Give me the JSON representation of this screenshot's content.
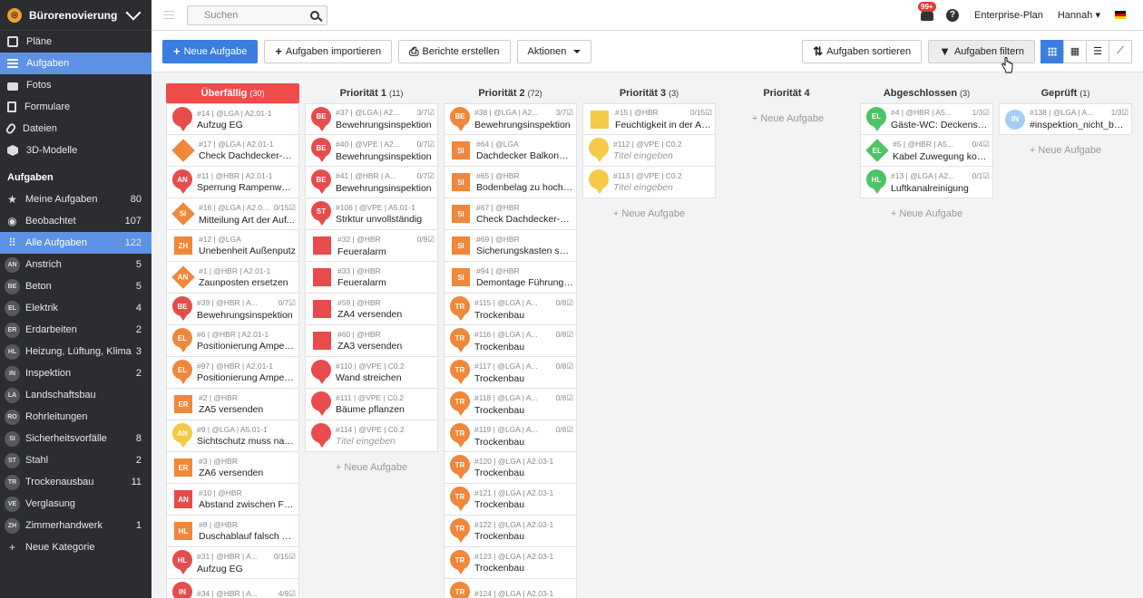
{
  "sidebar": {
    "project": "Bürorenovierung",
    "nav": [
      {
        "label": "Pläne",
        "icon": "plans-icon"
      },
      {
        "label": "Aufgaben",
        "icon": "list-icon",
        "active": true
      },
      {
        "label": "Fotos",
        "icon": "camera-icon"
      },
      {
        "label": "Formulare",
        "icon": "form-icon"
      },
      {
        "label": "Dateien",
        "icon": "paperclip-icon"
      },
      {
        "label": "3D-Modelle",
        "icon": "cube-icon"
      }
    ],
    "section_title": "Aufgaben",
    "filters": [
      {
        "label": "Meine Aufgaben",
        "count": "80",
        "sym": "★"
      },
      {
        "label": "Beobachtet",
        "count": "107",
        "sym": "◉"
      },
      {
        "label": "Alle Aufgaben",
        "count": "122",
        "sym": "⠿",
        "active": true
      }
    ],
    "categories": [
      {
        "badge": "AN",
        "label": "Anstrich",
        "count": "5"
      },
      {
        "badge": "BE",
        "label": "Beton",
        "count": "5"
      },
      {
        "badge": "EL",
        "label": "Elektrik",
        "count": "4"
      },
      {
        "badge": "ER",
        "label": "Erdarbeiten",
        "count": "2"
      },
      {
        "badge": "HL",
        "label": "Heizung, Lüftung, Klima",
        "count": "3"
      },
      {
        "badge": "IN",
        "label": "Inspektion",
        "count": "2"
      },
      {
        "badge": "LA",
        "label": "Landschaftsbau",
        "count": ""
      },
      {
        "badge": "RO",
        "label": "Rohrleitungen",
        "count": ""
      },
      {
        "badge": "SI",
        "label": "Sicherheitsvorfälle",
        "count": "8"
      },
      {
        "badge": "ST",
        "label": "Stahl",
        "count": "2"
      },
      {
        "badge": "TR",
        "label": "Trockenausbau",
        "count": "11"
      },
      {
        "badge": "VE",
        "label": "Verglasung",
        "count": ""
      },
      {
        "badge": "ZH",
        "label": "Zimmerhandwerk",
        "count": "1"
      }
    ],
    "new_category": "Neue Kategorie"
  },
  "topbar": {
    "search_placeholder": "Suchen",
    "notifications": "99+",
    "help": "?",
    "plan": "Enterprise-Plan",
    "user": "Hannah"
  },
  "toolbar": {
    "new_task": "Neue Aufgabe",
    "import": "Aufgaben importieren",
    "reports": "Berichte erstellen",
    "actions": "Aktionen",
    "sort": "Aufgaben sortieren",
    "filter": "Aufgaben filtern"
  },
  "board": {
    "add_label": "+ Neue Aufgabe",
    "columns": [
      {
        "title": "Überfällig",
        "count": "(30)",
        "overdue": true,
        "show_add": false,
        "cards": [
          {
            "meta": "#14 | @LGA | A2.01-1",
            "sub": "",
            "title": "Aufzug EG",
            "shape": "pin",
            "color": "#e84b4b",
            "badge": ""
          },
          {
            "meta": "#17 | @LGA | A2.01-1",
            "sub": "",
            "title": "Check Dachdecker-Ar...",
            "shape": "dia",
            "color": "#f0873a",
            "badge": ""
          },
          {
            "meta": "#11 | @HBR | A2.01-1",
            "sub": "",
            "title": "Sperrung Rampenwan...",
            "shape": "pin",
            "color": "#e84b4b",
            "badge": "AN"
          },
          {
            "meta": "#16 | @LGA | A2.01-...",
            "sub": "0/15☑",
            "title": "Mitteilung Art der Auf...",
            "shape": "dia",
            "color": "#f0873a",
            "badge": "SI"
          },
          {
            "meta": "#12 | @LGA",
            "sub": "",
            "title": "Unebenheit Außenputz",
            "shape": "sq",
            "color": "#f0873a",
            "badge": "ZH"
          },
          {
            "meta": "#1 | @HBR | A2.01-1",
            "sub": "",
            "title": "Zaunposten ersetzen",
            "shape": "dia",
            "color": "#f0873a",
            "badge": "AN"
          },
          {
            "meta": "#39 | @HBR | A...",
            "sub": "0/7☑",
            "title": "Bewehrungsinspektion",
            "shape": "pin",
            "color": "#e84b4b",
            "badge": "BE"
          },
          {
            "meta": "#6 | @HBR | A2.01-1",
            "sub": "",
            "title": "Positionierung Ampela...",
            "shape": "pin",
            "color": "#f0873a",
            "badge": "EL"
          },
          {
            "meta": "#97 | @HBR | A2.01-1",
            "sub": "",
            "title": "Positionierung Ampela...",
            "shape": "pin",
            "color": "#f0873a",
            "badge": "EL"
          },
          {
            "meta": "#2 | @HBR",
            "sub": "",
            "title": "ZA5 versenden",
            "shape": "sq",
            "color": "#f0873a",
            "badge": "ER"
          },
          {
            "meta": "#9 | @LGA | A5.01-1",
            "sub": "",
            "title": "Sichtschutz muss nachl...",
            "shape": "pin",
            "color": "#f5c842",
            "badge": "AN"
          },
          {
            "meta": "#3 | @HBR",
            "sub": "",
            "title": "ZA6 versenden",
            "shape": "sq",
            "color": "#f0873a",
            "badge": "ER"
          },
          {
            "meta": "#10 | @HBR",
            "sub": "",
            "title": "Abstand zwischen Fen...",
            "shape": "sq",
            "color": "#e84b4b",
            "badge": "AN"
          },
          {
            "meta": "#8 | @HBR",
            "sub": "",
            "title": "Duschablauf falsch pos...",
            "shape": "sq",
            "color": "#f0873a",
            "badge": "HL"
          },
          {
            "meta": "#31 | @HBR | A...",
            "sub": "0/15☑",
            "title": "Aufzug EG",
            "shape": "pin",
            "color": "#e84b4b",
            "badge": "HL"
          },
          {
            "meta": "#34 | @HBR | A...",
            "sub": "4/9☑",
            "title": "",
            "shape": "pin",
            "color": "#e84b4b",
            "badge": "IN"
          }
        ]
      },
      {
        "title": "Priorität 1",
        "count": "(11)",
        "show_add": true,
        "cards": [
          {
            "meta": "#37 | @LGA | A2...",
            "sub": "3/7☑",
            "title": "Bewehrungsinspektion",
            "shape": "pin",
            "color": "#e84b4b",
            "badge": "BE"
          },
          {
            "meta": "#40 | @VPE | A2...",
            "sub": "0/7☑",
            "title": "Bewehrungsinspektion",
            "shape": "pin",
            "color": "#e84b4b",
            "badge": "BE"
          },
          {
            "meta": "#41 | @HBR | A...",
            "sub": "0/7☑",
            "title": "Bewehrungsinspektion",
            "shape": "pin",
            "color": "#e84b4b",
            "badge": "BE"
          },
          {
            "meta": "#106 | @VPE | A5.01-1",
            "sub": "",
            "title": "Strktur unvollständig",
            "shape": "pin",
            "color": "#e84b4b",
            "badge": "ST"
          },
          {
            "meta": "#32 | @HBR",
            "sub": "0/9☑",
            "title": "Feueralarm",
            "shape": "sq",
            "color": "#e84b4b",
            "badge": ""
          },
          {
            "meta": "#33 | @HBR",
            "sub": "",
            "title": "Feueralarm",
            "shape": "sq",
            "color": "#e84b4b",
            "badge": ""
          },
          {
            "meta": "#59 | @HBR",
            "sub": "",
            "title": "ZA4 versenden",
            "shape": "sq",
            "color": "#e84b4b",
            "badge": ""
          },
          {
            "meta": "#60 | @HBR",
            "sub": "",
            "title": "ZA3 versenden",
            "shape": "sq",
            "color": "#e84b4b",
            "badge": ""
          },
          {
            "meta": "#110 | @VPE | C0.2",
            "sub": "",
            "title": "Wand streichen",
            "shape": "pin",
            "color": "#e84b4b",
            "badge": ""
          },
          {
            "meta": "#111 | @VPE | C0.2",
            "sub": "",
            "title": "Bäume pflanzen",
            "shape": "pin",
            "color": "#e84b4b",
            "badge": ""
          },
          {
            "meta": "#114 | @VPE | C0.2",
            "sub": "",
            "title": "Titel eingeben",
            "placeholder": true,
            "shape": "pin",
            "color": "#e84b4b",
            "badge": ""
          }
        ]
      },
      {
        "title": "Priorität 2",
        "count": "(72)",
        "show_add": false,
        "cards": [
          {
            "meta": "#38 | @LGA | A2...",
            "sub": "3/7☑",
            "title": "Bewehrungsinspektion",
            "shape": "pin",
            "color": "#f0873a",
            "badge": "BE"
          },
          {
            "meta": "#64 | @LGA",
            "sub": "",
            "title": "Dachdecker Balkone &...",
            "shape": "sq",
            "color": "#f0873a",
            "badge": "SI"
          },
          {
            "meta": "#65 | @HBR",
            "sub": "",
            "title": "Bodenbelag zu hoch W...",
            "shape": "sq",
            "color": "#f0873a",
            "badge": "SI"
          },
          {
            "meta": "#67 | @HBR",
            "sub": "",
            "title": "Check Dachdecker-Ar...",
            "shape": "sq",
            "color": "#f0873a",
            "badge": "SI"
          },
          {
            "meta": "#69 | @HBR",
            "sub": "",
            "title": "Sicherungskasten schief",
            "shape": "sq",
            "color": "#f0873a",
            "badge": "SI"
          },
          {
            "meta": "#94 | @HBR",
            "sub": "",
            "title": "Demontage Führungss...",
            "shape": "sq",
            "color": "#f0873a",
            "badge": "SI"
          },
          {
            "meta": "#115 | @LGA | A...",
            "sub": "0/8☑",
            "title": "Trockenbau",
            "shape": "pin",
            "color": "#f0873a",
            "badge": "TR"
          },
          {
            "meta": "#116 | @LGA | A...",
            "sub": "0/8☑",
            "title": "Trockenbau",
            "shape": "pin",
            "color": "#f0873a",
            "badge": "TR"
          },
          {
            "meta": "#117 | @LGA | A...",
            "sub": "0/8☑",
            "title": "Trockenbau",
            "shape": "pin",
            "color": "#f0873a",
            "badge": "TR"
          },
          {
            "meta": "#118 | @LGA | A...",
            "sub": "0/8☑",
            "title": "Trockenbau",
            "shape": "pin",
            "color": "#f0873a",
            "badge": "TR"
          },
          {
            "meta": "#119 | @LGA | A...",
            "sub": "0/8☑",
            "title": "Trockenbau",
            "shape": "pin",
            "color": "#f0873a",
            "badge": "TR"
          },
          {
            "meta": "#120 | @LGA | A2.03-1",
            "sub": "",
            "title": "Trockenbau",
            "shape": "pin",
            "color": "#f0873a",
            "badge": "TR"
          },
          {
            "meta": "#121 | @LGA | A2.03-1",
            "sub": "",
            "title": "Trockenbau",
            "shape": "pin",
            "color": "#f0873a",
            "badge": "TR"
          },
          {
            "meta": "#122 | @LGA | A2.03-1",
            "sub": "",
            "title": "Trockenbau",
            "shape": "pin",
            "color": "#f0873a",
            "badge": "TR"
          },
          {
            "meta": "#123 | @LGA | A2.03-1",
            "sub": "",
            "title": "Trockenbau",
            "shape": "pin",
            "color": "#f0873a",
            "badge": "TR"
          },
          {
            "meta": "#124 | @LGA | A2.03-1",
            "sub": "",
            "title": "",
            "shape": "pin",
            "color": "#f0873a",
            "badge": "TR"
          }
        ]
      },
      {
        "title": "Priorität 3",
        "count": "(3)",
        "show_add": true,
        "cards": [
          {
            "meta": "#15 | @HBR",
            "sub": "0/15☑",
            "title": "Feuchtigkeit in der Auf...",
            "shape": "sq",
            "color": "#f7c948",
            "badge": ""
          },
          {
            "meta": "#112 | @VPE | C0.2",
            "sub": "",
            "title": "Titel eingeben",
            "placeholder": true,
            "shape": "pin",
            "color": "#f7c948",
            "badge": ""
          },
          {
            "meta": "#113 | @VPE | C0.2",
            "sub": "",
            "title": "Titel eingeben",
            "placeholder": true,
            "shape": "pin",
            "color": "#f7c948",
            "badge": ""
          }
        ]
      },
      {
        "title": "Priorität 4",
        "count": "",
        "show_add": true,
        "cards": []
      },
      {
        "title": "Abgeschlossen",
        "count": "(3)",
        "show_add": true,
        "cards": [
          {
            "meta": "#4 | @HBR | A5...",
            "sub": "1/3☑",
            "title": "Gäste-WC: Deckenspo...",
            "shape": "pin",
            "color": "#4cc464",
            "badge": "EL"
          },
          {
            "meta": "#5 | @HBR | A5...",
            "sub": "0/4☑",
            "title": "Kabel Zuwegung kontr...",
            "shape": "dia",
            "color": "#4cc464",
            "badge": "EL"
          },
          {
            "meta": "#13 | @LGA | A2...",
            "sub": "0/1☑",
            "title": "Luftkanalreinigung",
            "shape": "pin",
            "color": "#4cc464",
            "badge": "HL"
          }
        ]
      },
      {
        "title": "Geprüft",
        "count": "(1)",
        "show_add": true,
        "cards": [
          {
            "meta": "#138 | @LGA | A...",
            "sub": "1/3☑",
            "title": "#inspektion_nicht_best...",
            "shape": "circ",
            "color": "#a8cdf0",
            "badge": "IN"
          }
        ]
      }
    ]
  }
}
